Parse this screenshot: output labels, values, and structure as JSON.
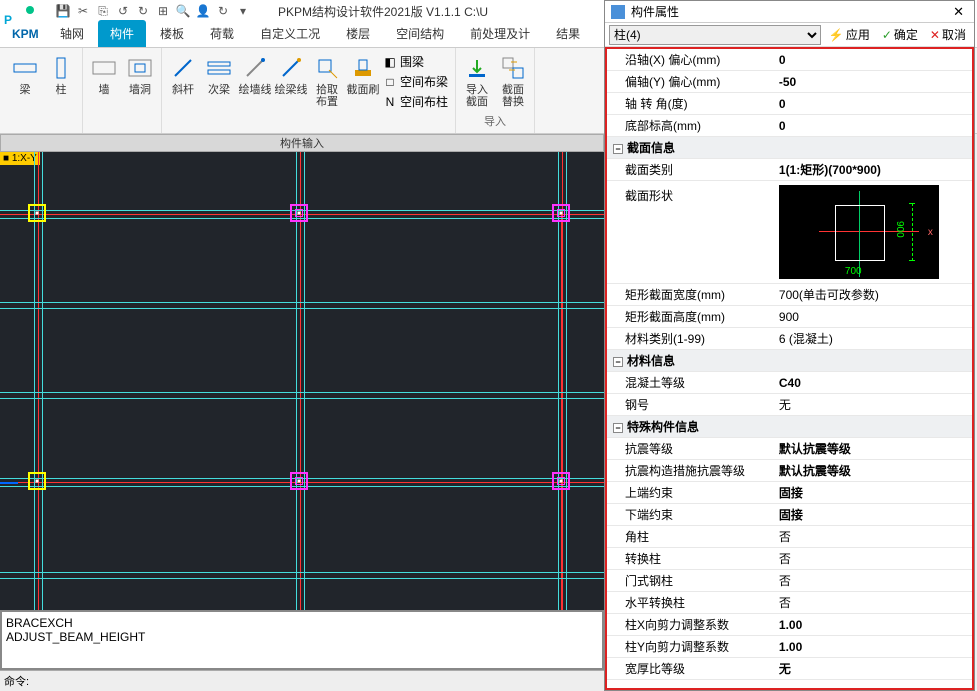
{
  "titlebar": {
    "title": "PKPM结构设计软件2021版 V1.1.1 C:\\U"
  },
  "menu": {
    "tabs": [
      "轴网",
      "构件",
      "楼板",
      "荷载",
      "自定义工况",
      "楼层",
      "空间结构",
      "前处理及计",
      "结果"
    ],
    "active": 1
  },
  "ribbon": {
    "groups": [
      {
        "items": [
          {
            "label": "梁"
          },
          {
            "label": "柱"
          }
        ]
      },
      {
        "items": [
          {
            "label": "墙"
          },
          {
            "label": "墙洞"
          }
        ]
      },
      {
        "items": [
          {
            "label": "斜杆"
          },
          {
            "label": "次梁"
          },
          {
            "label": "绘墙线"
          },
          {
            "label": "绘梁线"
          },
          {
            "label": "拾取\n布置"
          },
          {
            "label": "截面刷"
          }
        ],
        "stack": [
          {
            "icon": "◧",
            "label": "围梁"
          },
          {
            "icon": "□",
            "label": "空间布梁"
          },
          {
            "icon": "N",
            "label": "空间布柱"
          }
        ]
      },
      {
        "items": [
          {
            "label": "导入\n截面"
          },
          {
            "label": "截面\n替换"
          }
        ],
        "caption": "导入"
      }
    ],
    "input_caption": "构件输入"
  },
  "canvas": {
    "tag": "■ 1:X-Y"
  },
  "cmd": {
    "lines": [
      "BRACEXCH",
      "ADJUST_BEAM_HEIGHT"
    ],
    "prompt": "命令:"
  },
  "panel": {
    "title": "构件属性",
    "selector": "柱(4)",
    "buttons": {
      "apply": "应用",
      "ok": "确定",
      "cancel": "取消"
    },
    "rows_top": [
      {
        "k": "沿轴(X) 偏心(mm)",
        "v": "0"
      },
      {
        "k": "偏轴(Y) 偏心(mm)",
        "v": "-50"
      },
      {
        "k": "轴 转 角(度)",
        "v": "0"
      },
      {
        "k": "底部标高(mm)",
        "v": "0"
      }
    ],
    "section1": {
      "title": "截面信息",
      "rows": [
        {
          "k": "截面类别",
          "v": "1(1:矩形)(700*900)",
          "bold": true
        },
        {
          "k": "截面形状",
          "shape": true,
          "w": "700",
          "h": "900"
        },
        {
          "k": "矩形截面宽度(mm)",
          "v": "700(单击可改参数)"
        },
        {
          "k": "矩形截面高度(mm)",
          "v": "900"
        },
        {
          "k": "材料类别(1-99)",
          "v": "6 (混凝土)"
        }
      ]
    },
    "section2": {
      "title": "材料信息",
      "rows": [
        {
          "k": "混凝土等级",
          "v": "C40",
          "bold": true
        },
        {
          "k": "钢号",
          "v": "无"
        }
      ]
    },
    "section3": {
      "title": "特殊构件信息",
      "rows": [
        {
          "k": "抗震等级",
          "v": "默认抗震等级",
          "bold": true
        },
        {
          "k": "抗震构造措施抗震等级",
          "v": "默认抗震等级",
          "bold": true
        },
        {
          "k": "上端约束",
          "v": "固接",
          "bold": true
        },
        {
          "k": "下端约束",
          "v": "固接",
          "bold": true
        },
        {
          "k": "角柱",
          "v": "否"
        },
        {
          "k": "转换柱",
          "v": "否"
        },
        {
          "k": "门式钢柱",
          "v": "否"
        },
        {
          "k": "水平转换柱",
          "v": "否"
        },
        {
          "k": "柱X向剪力调整系数",
          "v": "1.00",
          "bold": true
        },
        {
          "k": "柱Y向剪力调整系数",
          "v": "1.00",
          "bold": true
        },
        {
          "k": "宽厚比等级",
          "v": "无",
          "bold": true
        }
      ]
    }
  },
  "chart_data": null
}
